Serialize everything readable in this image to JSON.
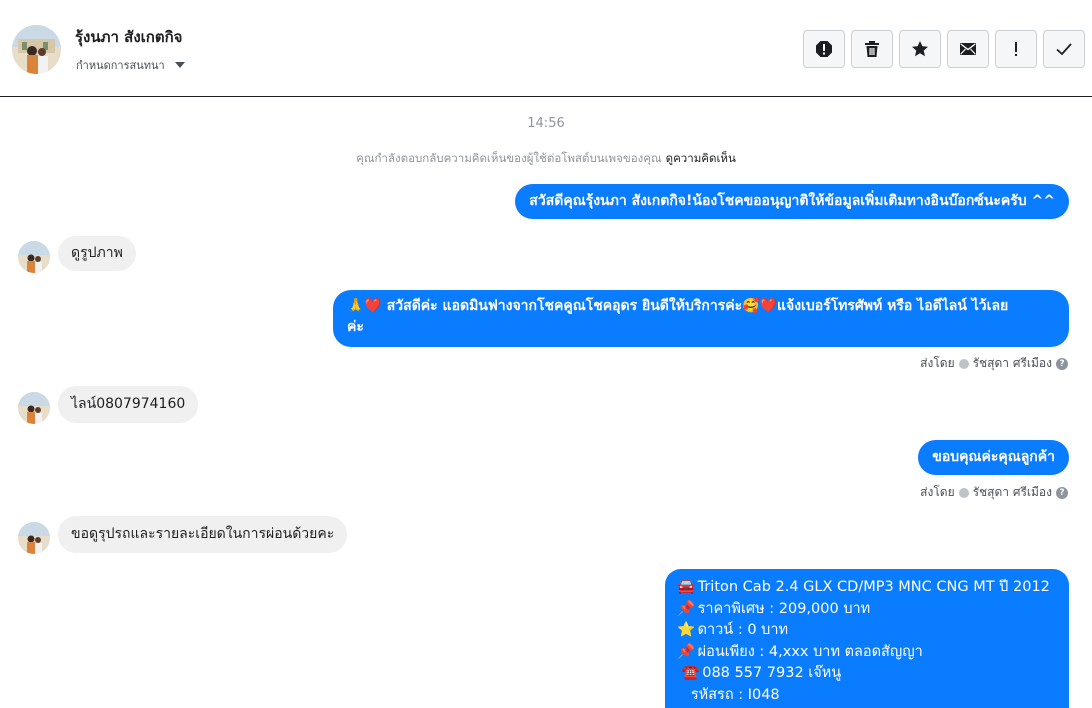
{
  "header": {
    "contact_name": "รุ้งนภา สังเกตกิจ",
    "assign_label": "กำหนดการสนทนา"
  },
  "actions": [
    {
      "name": "report-spam-icon"
    },
    {
      "name": "trash-icon"
    },
    {
      "name": "star-icon"
    },
    {
      "name": "mail-icon"
    },
    {
      "name": "important-icon"
    },
    {
      "name": "check-icon"
    }
  ],
  "thread": {
    "timestamp": "14:56",
    "notice_text": "คุณกำลังตอบกลับความคิดเห็นของผู้ใช้ต่อโพสต์บนเพจของคุณ",
    "notice_link": "ดูความคิดเห็น",
    "sent_by_label": "ส่งโดย",
    "sent_by_name": "รัชสุดา ศรีเมือง",
    "messages": [
      {
        "text": "สวัสดีคุณรุ้งนภา สังเกตกิจ!น้องโชคขออนุญาติให้ข้อมูลเพิ่มเติมทางอินบ๊อกซ์นะครับ ^^"
      },
      {
        "text": "ดูรูปภาพ"
      },
      {
        "line1": "🙏❤️ สวัสดีค่ะ แอดมินฟางจากโชคคูณโชคอุดร ยินดีให้บริการค่ะ🥰❤️แจ้งเบอร์โทรศัพท์ หรือ ไอดีไลน์  ไว้เลย",
        "line2": "ค่ะ"
      },
      {
        "text": "ไลน์0807974160"
      },
      {
        "text": "ขอบคุณค่ะคุณลูกค้า"
      },
      {
        "text": "ขอดูรุปรถและรายละเอียดในการผ่อนด้วยคะ"
      },
      {
        "l1": "Triton Cab 2.4 GLX CD/MP3 MNC  CNG MT ปี 2012",
        "l2": "ราคาพิเศษ : 209,000 บาท",
        "l3": "ดาวน์ : 0 บาท",
        "l4": "ผ่อนเพียง : 4,xxx บาท ตลอดสัญญา",
        "l5": "088 557 7932 เจ๊หนู",
        "l6": "รหัสรถ : I048"
      }
    ]
  },
  "colors": {
    "accent": "#0a7cff",
    "incoming": "#f0f0f0"
  }
}
